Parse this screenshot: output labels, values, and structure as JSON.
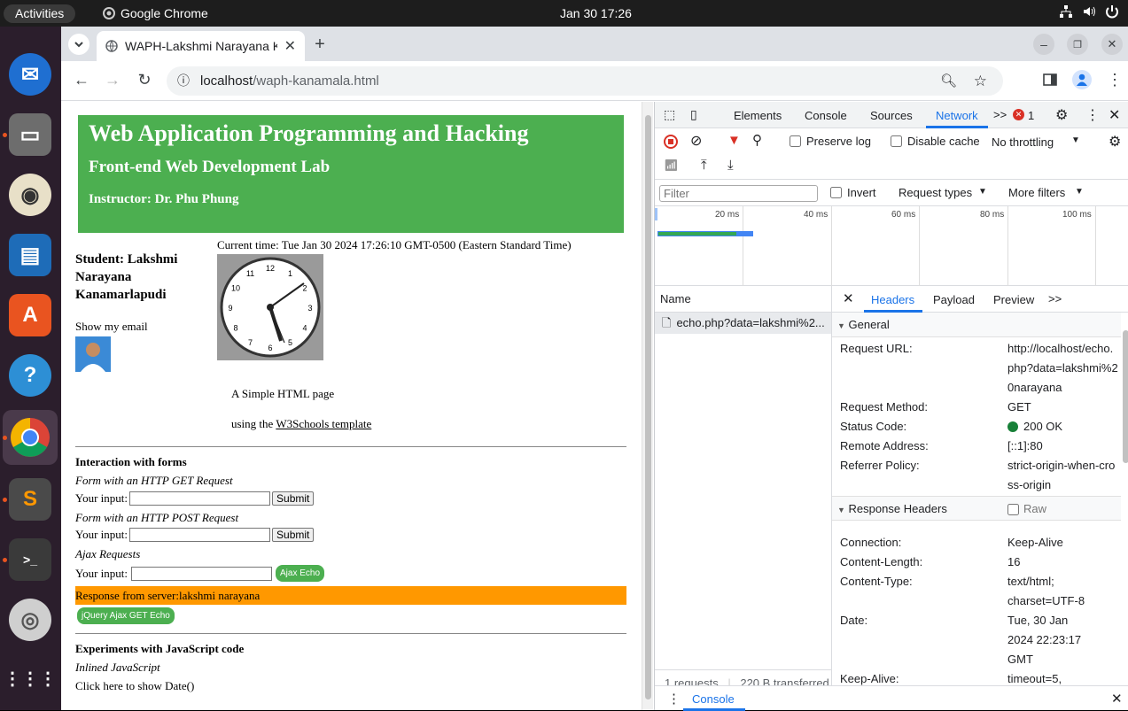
{
  "topbar": {
    "activities": "Activities",
    "app_name": "Google Chrome",
    "clock": "Jan 30  17:26",
    "icons": [
      "network-icon",
      "volume-icon",
      "power-icon"
    ]
  },
  "dock": {
    "apps": [
      "thunderbird",
      "files",
      "rhythmbox",
      "libreoffice-writer",
      "ubuntu-software",
      "help",
      "chrome",
      "sublime-text",
      "terminal",
      "dvd",
      "show-apps"
    ]
  },
  "browser": {
    "tab_title": "WAPH-Lakshmi Narayana Kanamarlapudi",
    "url_host": "localhost",
    "url_path": "/waph-kanamala.html"
  },
  "page": {
    "header_title": "Web Application Programming and Hacking",
    "header_subtitle": "Front-end Web Development Lab",
    "instructor": "Instructor: Dr. Phu Phung",
    "current_time": "Current time: Tue Jan 30 2024 17:26:10 GMT-0500 (Eastern Standard Time)",
    "student_line1": "Student: Lakshmi",
    "student_line2": "Narayana",
    "student_line3": "Kanamarlapudi",
    "show_email": "Show my email",
    "simple_html": "A Simple HTML page",
    "using_the": "using the ",
    "w3_link": "W3Schools template",
    "interaction_heading": "Interaction with forms",
    "get_form_label": "Form with an HTTP GET Request",
    "your_input": "Your input:",
    "submit": "Submit",
    "post_form_label": "Form with an HTTP POST Request",
    "ajax_requests": "Ajax Requests",
    "ajax_echo": "Ajax Echo",
    "response": "Response from server:lakshmi narayana",
    "jquery_button": "jQuery Ajax GET Echo",
    "experiments_heading": "Experiments with JavaScript code",
    "inlined_js": "Inlined JavaScript",
    "show_date": "Click here to show Date()",
    "clock_numbers": [
      "12",
      "1",
      "2",
      "3",
      "4",
      "5",
      "6",
      "7",
      "8",
      "9",
      "10",
      "11"
    ]
  },
  "devtools": {
    "tabs": [
      "Elements",
      "Console",
      "Sources",
      "Network"
    ],
    "active_tab": "Network",
    "more": ">>",
    "error_count": "1",
    "preserve_log": "Preserve log",
    "disable_cache": "Disable cache",
    "throttling": "No throttling",
    "filter_placeholder": "Filter",
    "invert": "Invert",
    "request_types": "Request types",
    "more_filters": "More filters",
    "timeline_ticks": [
      "20 ms",
      "40 ms",
      "60 ms",
      "80 ms",
      "100 ms"
    ],
    "name_col": "Name",
    "request_name": "echo.php?data=lakshmi%2...",
    "detail_tabs": [
      "Headers",
      "Payload",
      "Preview"
    ],
    "general_section": "General",
    "general": [
      {
        "k": "Request URL:",
        "v": "http://localhost/echo.php?data=lakshmi%20narayana"
      },
      {
        "k": "Request Method:",
        "v": "GET"
      },
      {
        "k": "Status Code:",
        "v": "200 OK"
      },
      {
        "k": "Remote Address:",
        "v": "[::1]:80"
      },
      {
        "k": "Referrer Policy:",
        "v": "strict-origin-when-cross-origin"
      }
    ],
    "response_section": "Response Headers",
    "raw": "Raw",
    "response_headers": [
      {
        "k": "Connection:",
        "v": "Keep-Alive"
      },
      {
        "k": "Content-Length:",
        "v": "16"
      },
      {
        "k": "Content-Type:",
        "v": "text/html; charset=UTF-8"
      },
      {
        "k": "Date:",
        "v": "Tue, 30 Jan 2024 22:23:17 GMT"
      },
      {
        "k": "Keep-Alive:",
        "v": "timeout=5,"
      }
    ],
    "requests_count": "1 requests",
    "transferred": "220 B transferred",
    "drawer_tab": "Console"
  },
  "colors": {
    "header_green": "#4caf50",
    "response_orange": "#ff9800",
    "devtools_blue": "#1a73e8",
    "status_green": "#188038"
  }
}
